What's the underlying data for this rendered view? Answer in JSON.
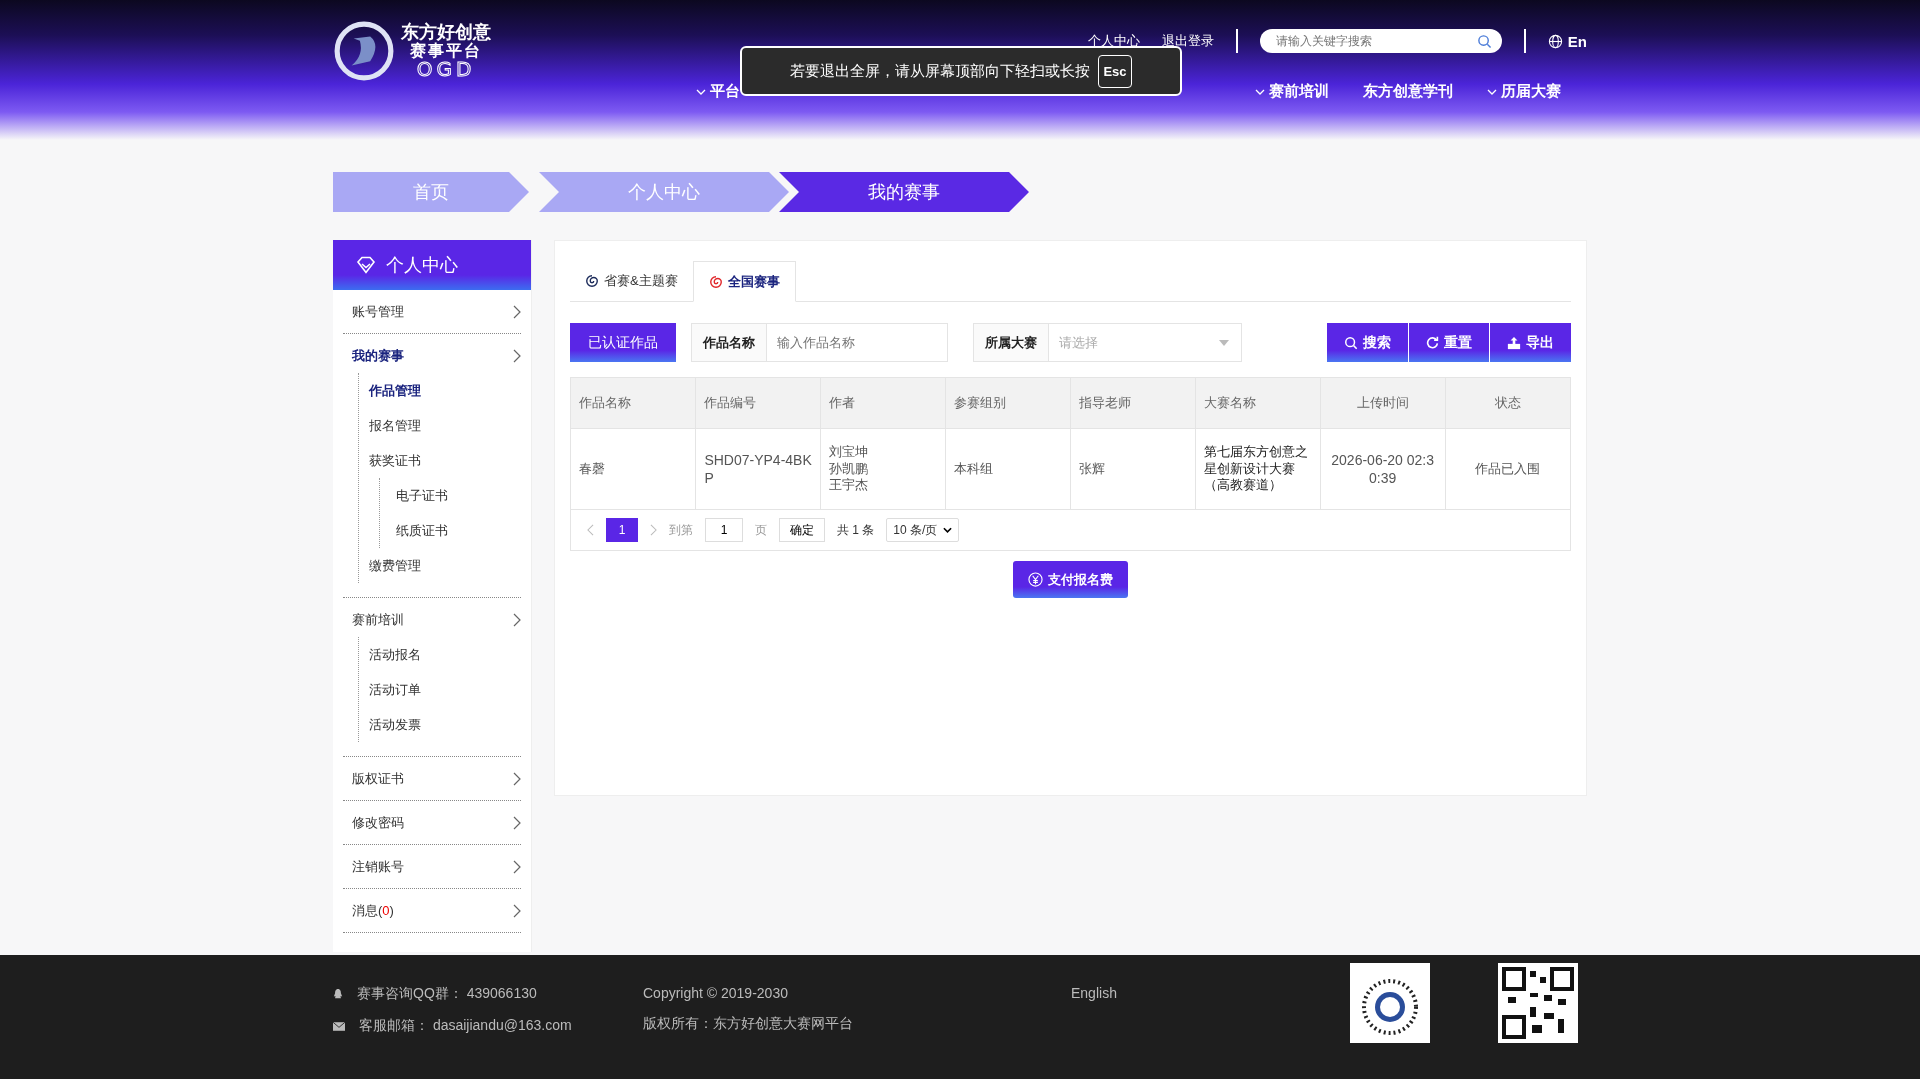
{
  "header": {
    "logo": {
      "line1": "东方好创意",
      "line2": "赛事平台",
      "line3": "OGD"
    },
    "links": [
      "个人中心",
      "退出登录"
    ],
    "search": {
      "placeholder": "请输入关键字搜索"
    },
    "language": "En",
    "nav": [
      {
        "label": "平台",
        "dropdown": true
      },
      {
        "label": "赛前培训",
        "dropdown": true
      },
      {
        "label": "东方创意学刊",
        "dropdown": false
      },
      {
        "label": "历届大赛",
        "dropdown": true
      }
    ]
  },
  "toast": {
    "text": "若要退出全屏，请从屏幕顶部向下轻扫或长按",
    "key": "Esc"
  },
  "breadcrumb": [
    {
      "label": "首页",
      "selected": false
    },
    {
      "label": "个人中心",
      "selected": false
    },
    {
      "label": "我的赛事",
      "selected": true
    }
  ],
  "sidebar": {
    "title": "个人中心",
    "groups": [
      {
        "label": "账号管理",
        "selected": false
      },
      {
        "label": "我的赛事",
        "selected": true,
        "children": [
          {
            "label": "作品管理",
            "selected": true
          },
          {
            "label": "报名管理",
            "selected": false
          },
          {
            "label": "获奖证书",
            "selected": false,
            "children": [
              {
                "label": "电子证书",
                "selected": false
              },
              {
                "label": "纸质证书",
                "selected": false
              }
            ]
          },
          {
            "label": "缴费管理",
            "selected": false
          }
        ]
      },
      {
        "label": "赛前培训",
        "selected": false,
        "children": [
          {
            "label": "活动报名",
            "selected": false
          },
          {
            "label": "活动订单",
            "selected": false
          },
          {
            "label": "活动发票",
            "selected": false
          }
        ]
      },
      {
        "label": "版权证书",
        "selected": false
      },
      {
        "label": "修改密码",
        "selected": false
      },
      {
        "label": "注销账号",
        "selected": false
      },
      {
        "label": "消息(",
        "count": "0",
        "label_end": ")",
        "selected": false
      }
    ]
  },
  "tabs": [
    {
      "label": "省赛&主题赛",
      "selected": false
    },
    {
      "label": "全国赛事",
      "selected": true
    }
  ],
  "filters": {
    "certified": "已认证作品",
    "name_field": {
      "label": "作品名称",
      "placeholder": "输入作品名称"
    },
    "contest_select": {
      "label": "所属大赛",
      "placeholder": "请选择"
    },
    "buttons": [
      {
        "label": "搜索",
        "kind": "search"
      },
      {
        "label": "重置",
        "kind": "reset"
      },
      {
        "label": "导出",
        "kind": "export"
      }
    ]
  },
  "table": {
    "columns": [
      "作品名称",
      "作品编号",
      "作者",
      "参赛组别",
      "指导老师",
      "大赛名称",
      "上传时间",
      "状态"
    ],
    "rows": [
      {
        "name": "春磬",
        "code": "SHD07-YP4-4BKP",
        "authors": [
          "刘宝坤",
          "孙凯鹏",
          "王宇杰"
        ],
        "group": "本科组",
        "teacher": "张辉",
        "contest": "第七届东方创意之星创新设计大赛（高教赛道）",
        "time": "2026-06-20 02:30:39",
        "status": "作品已入围"
      }
    ]
  },
  "pagination": {
    "current": "1",
    "goto_label": "到第",
    "goto_value": "1",
    "unit": "页",
    "confirm": "确定",
    "total": "共 1 条",
    "page_size": "10 条/页"
  },
  "pay_button": "支付报名费",
  "footer": {
    "qq": "赛事咨询QQ群： 439066130",
    "email": "客服邮箱： dasaijiandu@163.com",
    "copyright": "Copyright © 2019-2030",
    "owner": "版权所有：东方好创意大赛网平台",
    "language": "English"
  }
}
